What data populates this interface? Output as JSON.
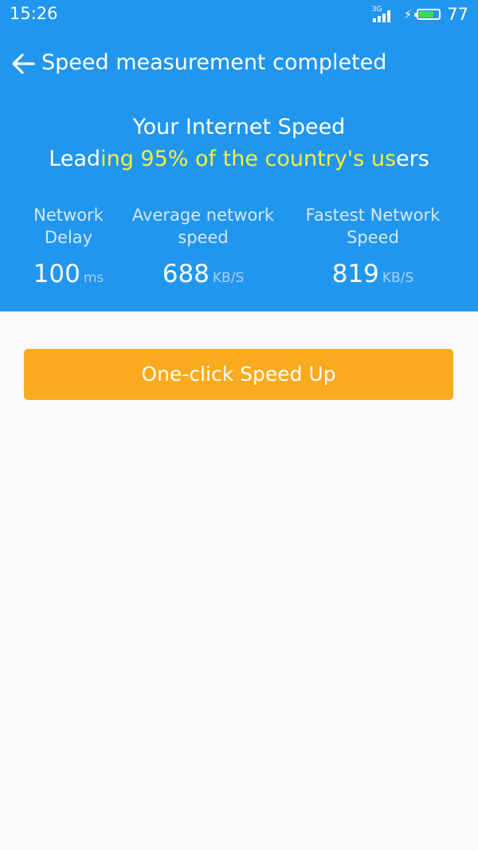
{
  "status_bar": {
    "time": "15:26",
    "network_type": "3G",
    "signal_strength": 4,
    "charging": true,
    "battery_level": 77,
    "battery_text": "77",
    "battery_color": "#3ed75a"
  },
  "header": {
    "title": "Speed measurement completed",
    "background_color": "#2196ee"
  },
  "result": {
    "heading": "Your Internet Speed",
    "leading_prefix": "Lead",
    "leading_highlight": "ing 95% of the country's us",
    "leading_suffix": "ers",
    "highlight_color": "#f6ee3d"
  },
  "stats": [
    {
      "label": "Network Delay",
      "value": "100",
      "unit": "ms"
    },
    {
      "label": "Average network speed",
      "value": "688",
      "unit": "KB/S"
    },
    {
      "label": "Fastest Network Speed",
      "value": "819",
      "unit": "KB/S"
    }
  ],
  "action": {
    "speed_up_label": "One-click Speed Up",
    "button_color": "#f9aa1e"
  }
}
